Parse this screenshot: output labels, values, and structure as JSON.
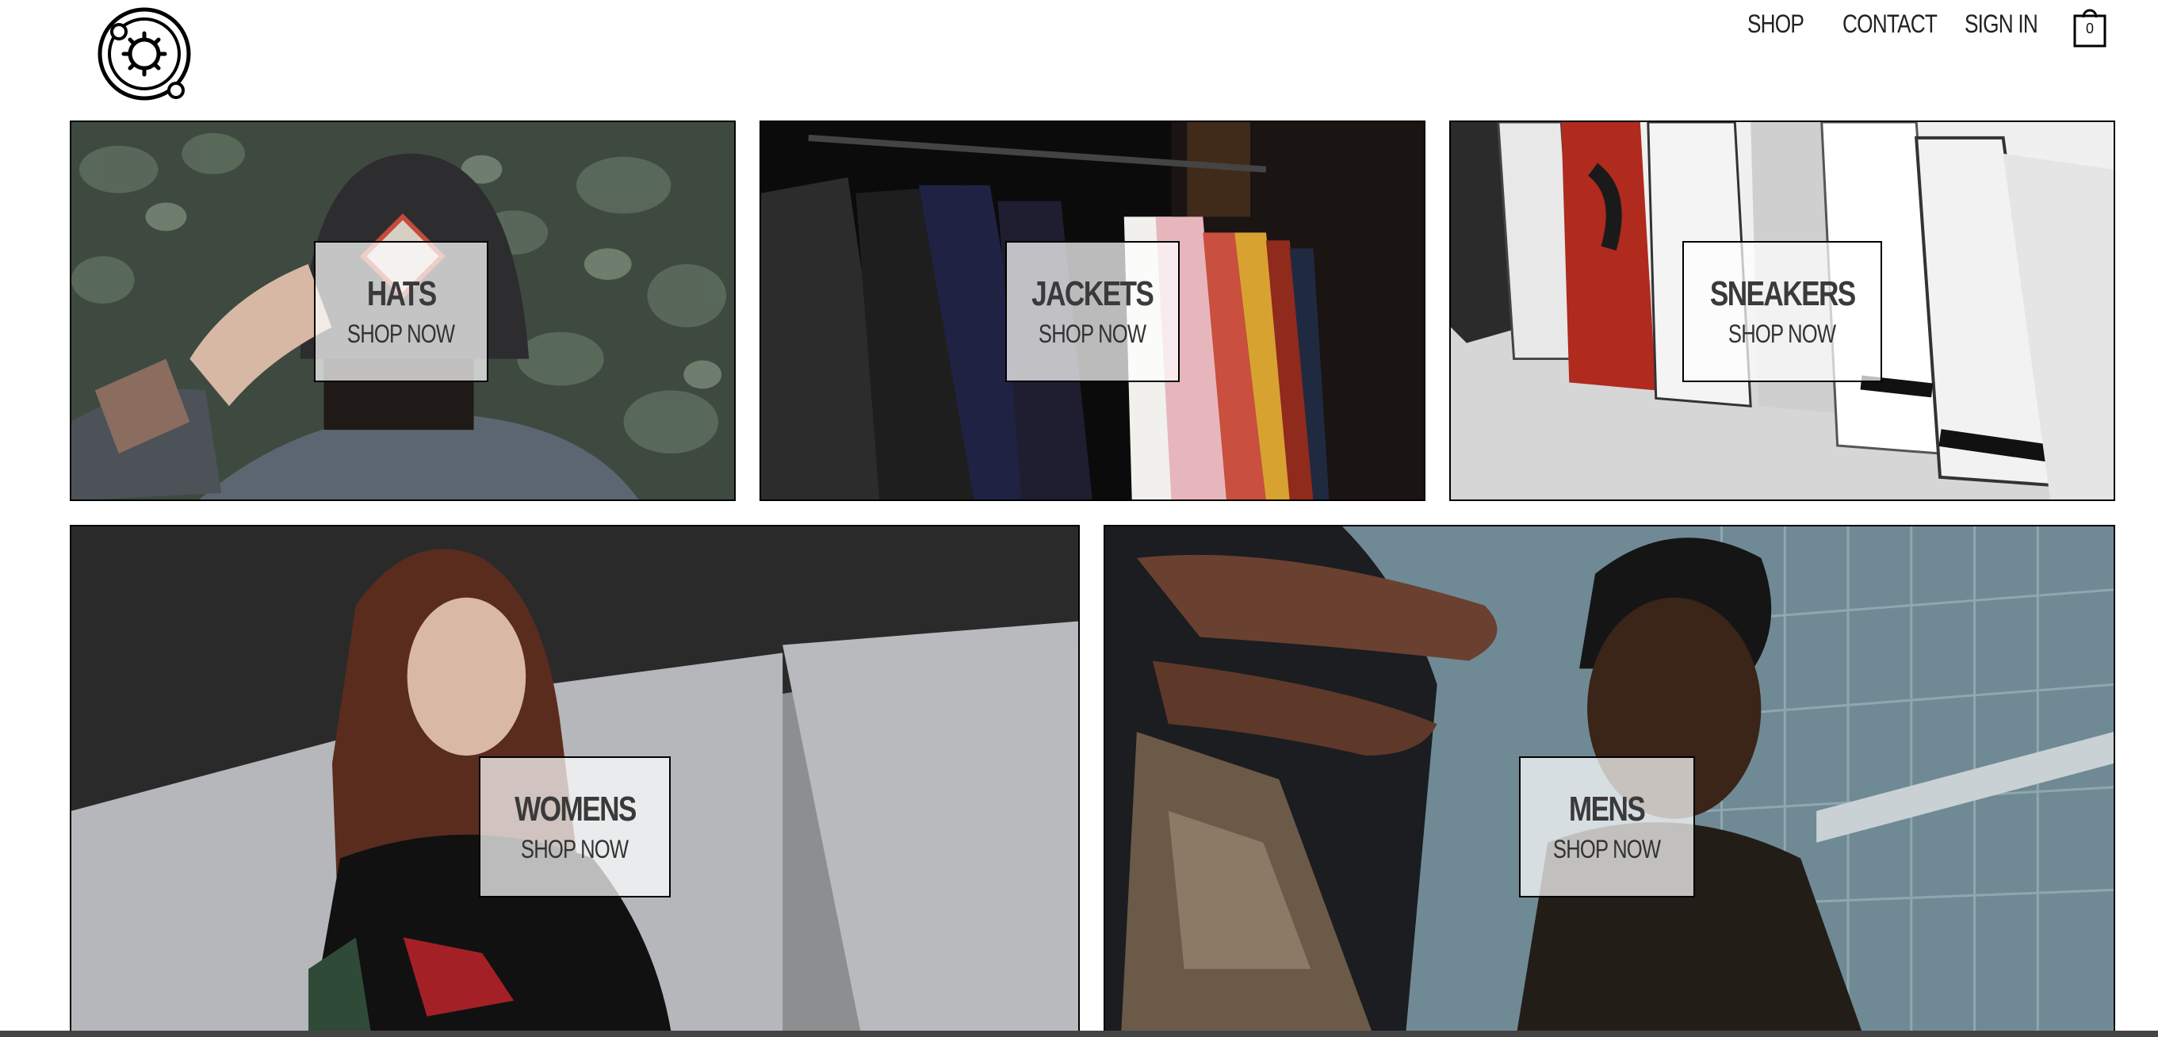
{
  "header": {
    "logo_name": "logo-icon",
    "nav": {
      "shop": "SHOP",
      "contact": "CONTACT",
      "sign_in": "SIGN IN"
    },
    "cart_count": "0"
  },
  "directory": [
    {
      "title": "HATS",
      "cta": "SHOP NOW"
    },
    {
      "title": "JACKETS",
      "cta": "SHOP NOW"
    },
    {
      "title": "SNEAKERS",
      "cta": "SHOP NOW"
    },
    {
      "title": "WOMENS",
      "cta": "SHOP NOW"
    },
    {
      "title": "MENS",
      "cta": "SHOP NOW"
    }
  ]
}
